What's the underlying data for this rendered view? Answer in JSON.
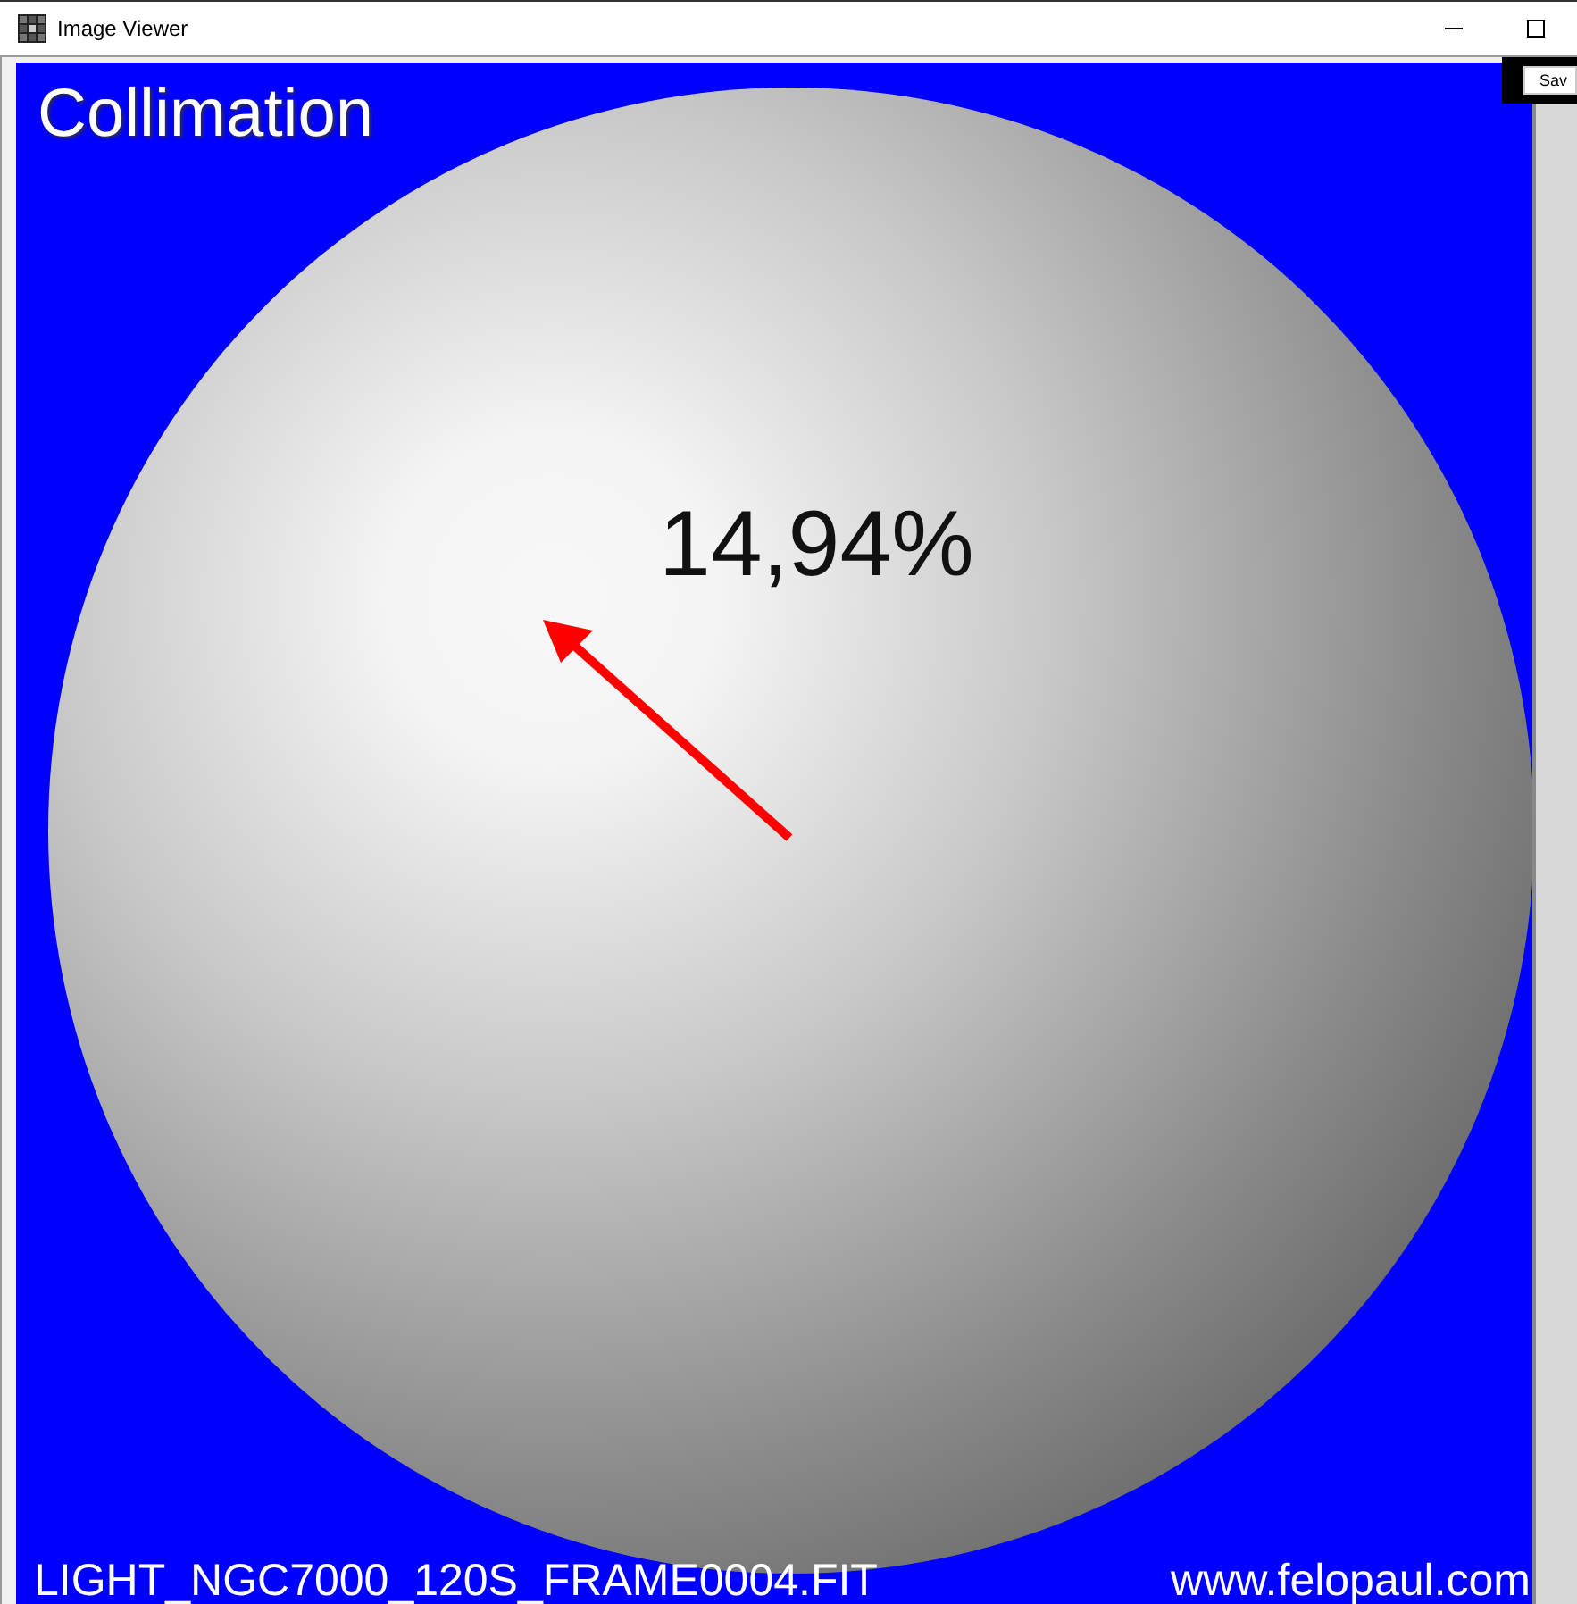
{
  "window": {
    "title": "Image Viewer"
  },
  "toolbar": {
    "save_button": "Sav"
  },
  "viewer": {
    "heading": "Collimation",
    "reading": "14,94%",
    "file_name": "LIGHT_NGC7000_120S_FRAME0004.FIT",
    "website": "www.felopaul.com"
  }
}
